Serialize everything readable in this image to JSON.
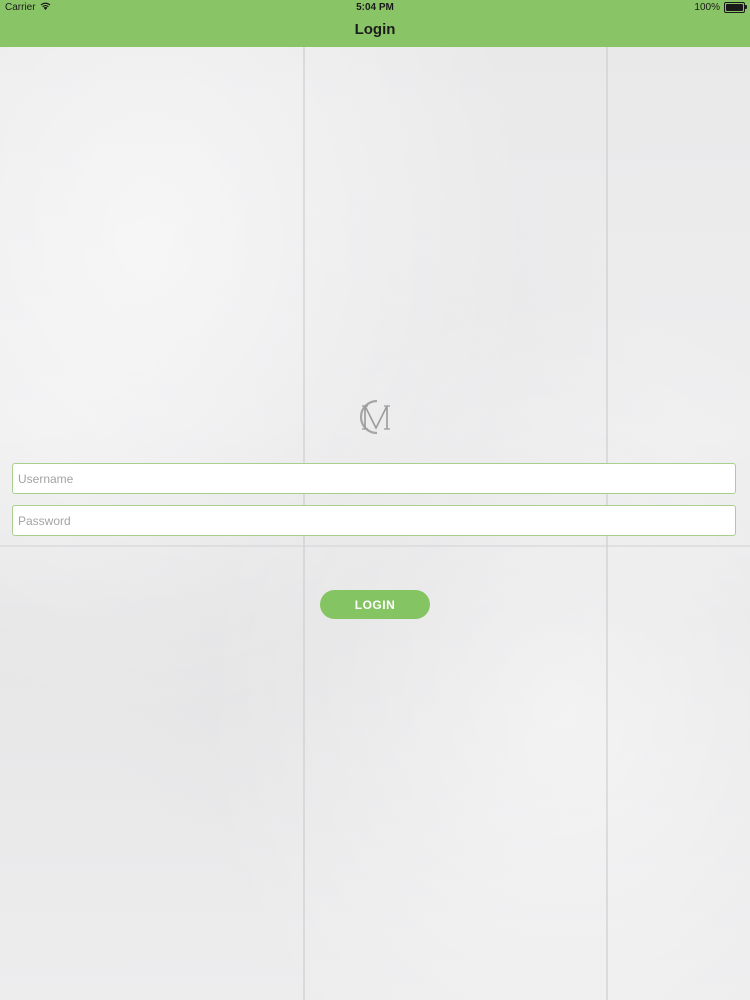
{
  "status_bar": {
    "carrier": "Carrier",
    "time": "5:04 PM",
    "battery_text": "100%",
    "battery_level": 1.0,
    "icons": [
      "wifi-icon",
      "battery-icon"
    ]
  },
  "nav": {
    "title": "Login"
  },
  "logo": {
    "description_icon": "monogram-logo"
  },
  "form": {
    "username_placeholder": "Username",
    "username_value": "",
    "password_placeholder": "Password",
    "password_value": "",
    "login_label": "LOGIN"
  },
  "colors": {
    "accent": "#89c566",
    "button": "#84c462",
    "field_border": "#a9cf8f",
    "background": "#ececec"
  }
}
